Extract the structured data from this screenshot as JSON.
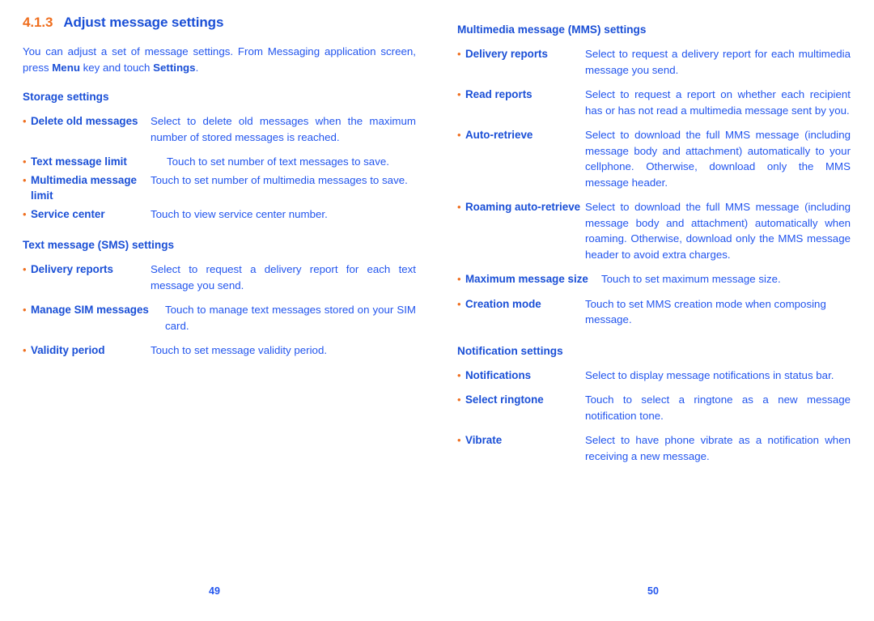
{
  "document": {
    "section_number": "4.1.3",
    "section_title": "Adjust message settings",
    "intro_part1": "You can adjust a set of message settings. From Messaging application screen, press ",
    "intro_bold1": "Menu",
    "intro_part2": " key and touch ",
    "intro_bold2": "Settings",
    "intro_part3": ".",
    "bullet_glyph": "•",
    "colors": {
      "accent_orange": "#ef6e1e",
      "heading_blue": "#1a4fd6",
      "body_blue": "#2255ee",
      "background": "#ffffff"
    }
  },
  "left_page": {
    "page_number": "49",
    "sections": [
      {
        "heading": "Storage settings",
        "items": [
          {
            "term": "Delete old messages",
            "desc": "Select to delete old messages when the maximum number of stored messages is reached."
          },
          {
            "term": "Text message limit",
            "desc": "Touch to set number of text messages to save."
          },
          {
            "term": "Multimedia message limit",
            "desc": "Touch to set number of multimedia messages to save."
          },
          {
            "term": "Service center",
            "desc": "Touch to view service center number."
          }
        ]
      },
      {
        "heading": "Text message (SMS) settings",
        "items": [
          {
            "term": "Delivery reports",
            "desc": "Select to request a delivery report for each text message you send."
          },
          {
            "term": "Manage SIM messages",
            "desc": "Touch to manage text messages stored on your SIM card."
          },
          {
            "term": "Validity period",
            "desc": "Touch to set message validity period."
          }
        ]
      }
    ]
  },
  "right_page": {
    "page_number": "50",
    "sections": [
      {
        "heading": "Multimedia message (MMS) settings",
        "items": [
          {
            "term": "Delivery reports",
            "desc": "Select to request a delivery report for each multimedia message you send."
          },
          {
            "term": "Read reports",
            "desc": "Select to request a report on whether each recipient has or has not read a multimedia message sent by you."
          },
          {
            "term": "Auto-retrieve",
            "desc": "Select to download the full MMS message (including message body and attachment) automatically to your cellphone. Otherwise, download only the MMS message header."
          },
          {
            "term": "Roaming auto-retrieve",
            "desc": "Select to download the full MMS message (including message body and attachment) automatically when roaming. Otherwise, download only the MMS message header to avoid extra charges."
          },
          {
            "term": "Maximum message size",
            "desc": "Touch to set maximum message size."
          },
          {
            "term": "Creation mode",
            "desc": "Touch to set MMS creation mode when composing message."
          }
        ]
      },
      {
        "heading": "Notification settings",
        "items": [
          {
            "term": "Notifications",
            "desc": "Select to display message notifications in status bar."
          },
          {
            "term": "Select ringtone",
            "desc": "Touch to select a ringtone as a new message notification tone."
          },
          {
            "term": "Vibrate",
            "desc": "Select to have phone vibrate as a notification when receiving a new message."
          }
        ]
      }
    ]
  }
}
